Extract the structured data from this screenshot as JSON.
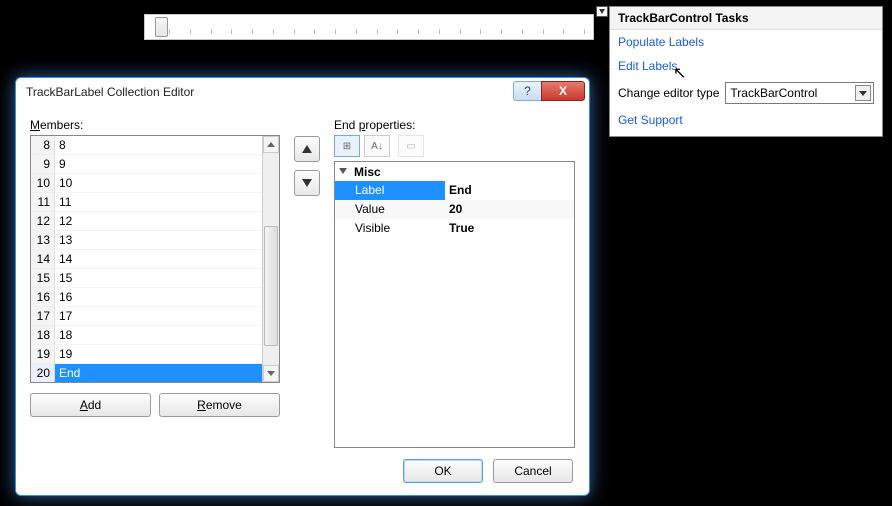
{
  "trackbar": {
    "tick_count": 21
  },
  "smart_panel": {
    "title": "TrackBarControl Tasks",
    "links": {
      "populate": "Populate Labels",
      "edit": "Edit Labels",
      "support": "Get Support"
    },
    "editor_label": "Change editor type",
    "editor_value": "TrackBarControl"
  },
  "dialog": {
    "title": "TrackBarLabel Collection Editor",
    "help_glyph": "?",
    "close_glyph": "X",
    "members_label_pre": "M",
    "members_label_rest": "embers:",
    "props_label_pre": "End ",
    "props_label_u": "p",
    "props_label_rest": "roperties:",
    "members": [
      {
        "idx": "8",
        "txt": "8"
      },
      {
        "idx": "9",
        "txt": "9"
      },
      {
        "idx": "10",
        "txt": "10"
      },
      {
        "idx": "11",
        "txt": "11"
      },
      {
        "idx": "12",
        "txt": "12"
      },
      {
        "idx": "13",
        "txt": "13"
      },
      {
        "idx": "14",
        "txt": "14"
      },
      {
        "idx": "15",
        "txt": "15"
      },
      {
        "idx": "16",
        "txt": "16"
      },
      {
        "idx": "17",
        "txt": "17"
      },
      {
        "idx": "18",
        "txt": "18"
      },
      {
        "idx": "19",
        "txt": "19"
      },
      {
        "idx": "20",
        "txt": "End",
        "selected": true
      }
    ],
    "add_label": "Add",
    "remove_label": "Remove",
    "toolbar": {
      "cat_glyph": "⊞",
      "az_glyph": "A↓",
      "page_glyph": "▭"
    },
    "prop_category": "Misc",
    "props": [
      {
        "name": "Label",
        "val": "End",
        "selected": true
      },
      {
        "name": "Value",
        "val": "20"
      },
      {
        "name": "Visible",
        "val": "True"
      }
    ],
    "ok_label": "OK",
    "cancel_label": "Cancel"
  }
}
